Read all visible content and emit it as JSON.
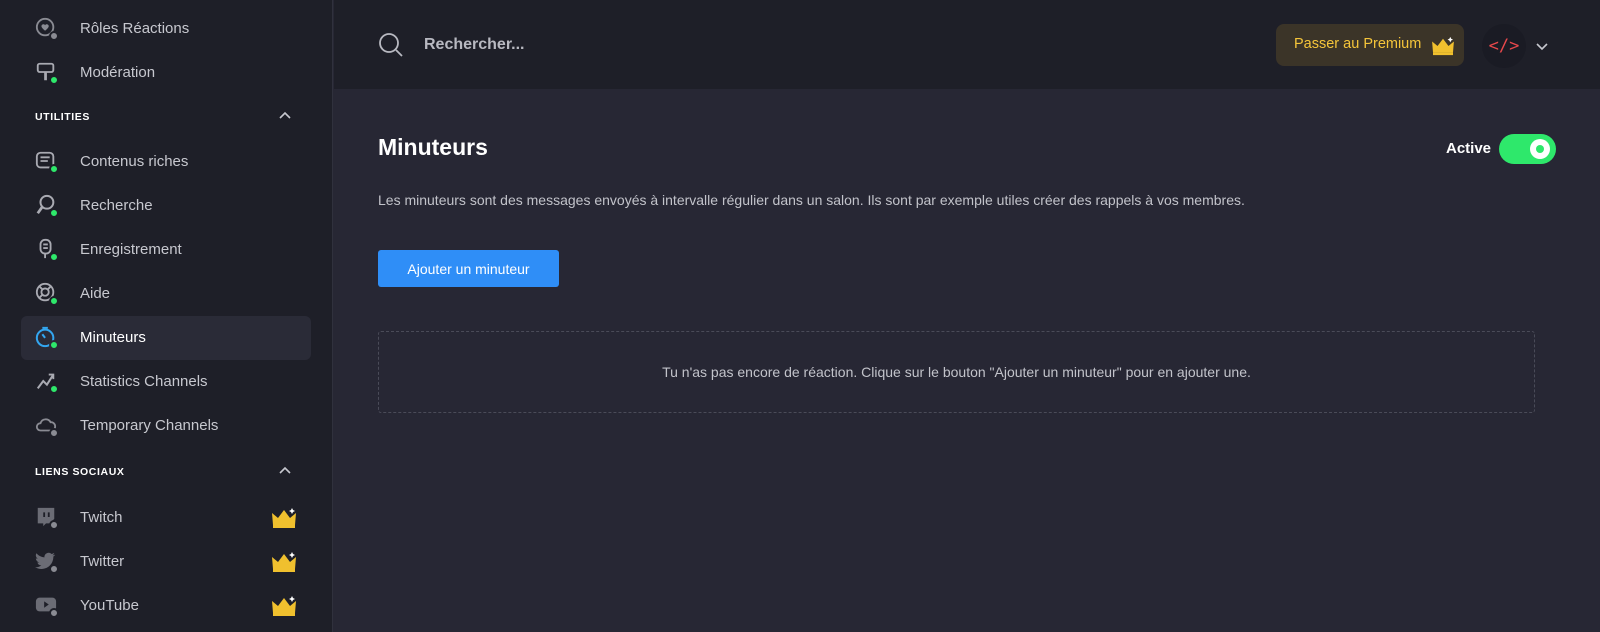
{
  "sidebar": {
    "items_top": [
      {
        "label": "Rôles Réactions",
        "icon": "heart-icon",
        "status": "grey"
      },
      {
        "label": "Modération",
        "icon": "hammer-icon",
        "status": "green"
      }
    ],
    "sections": [
      {
        "title": "UTILITIES",
        "items": [
          {
            "label": "Contenus riches",
            "icon": "message-icon",
            "status": "green"
          },
          {
            "label": "Recherche",
            "icon": "magnifier-icon",
            "status": "green"
          },
          {
            "label": "Enregistrement",
            "icon": "recording-icon",
            "status": "green"
          },
          {
            "label": "Aide",
            "icon": "help-icon",
            "status": "green"
          },
          {
            "label": "Minuteurs",
            "icon": "timer-icon",
            "status": "green",
            "active": true
          },
          {
            "label": "Statistics Channels",
            "icon": "chart-icon",
            "status": "green"
          },
          {
            "label": "Temporary Channels",
            "icon": "cloud-icon",
            "status": "grey"
          }
        ]
      },
      {
        "title": "LIENS SOCIAUX",
        "items": [
          {
            "label": "Twitch",
            "icon": "twitch-icon",
            "status": "grey",
            "premium": true
          },
          {
            "label": "Twitter",
            "icon": "twitter-icon",
            "status": "grey",
            "premium": true
          },
          {
            "label": "YouTube",
            "icon": "youtube-icon",
            "status": "grey",
            "premium": true
          }
        ]
      }
    ]
  },
  "header": {
    "search_placeholder": "Rechercher...",
    "premium_label": "Passer au Premium",
    "avatar_text": "</>"
  },
  "main": {
    "title": "Minuteurs",
    "toggle_label": "Active",
    "toggle_on": true,
    "description": "Les minuteurs sont des messages envoyés à intervalle régulier dans un salon. Ils sont par exemple utiles créer des rappels à vos membres.",
    "add_button": "Ajouter un minuteur",
    "empty_message": "Tu n'as pas encore de réaction. Clique sur le bouton \"Ajouter un minuteur\" pour en ajouter une."
  },
  "colors": {
    "accent_green": "#2ee86b",
    "primary_blue": "#2f8ef7",
    "premium_gold": "#f5c53a"
  }
}
